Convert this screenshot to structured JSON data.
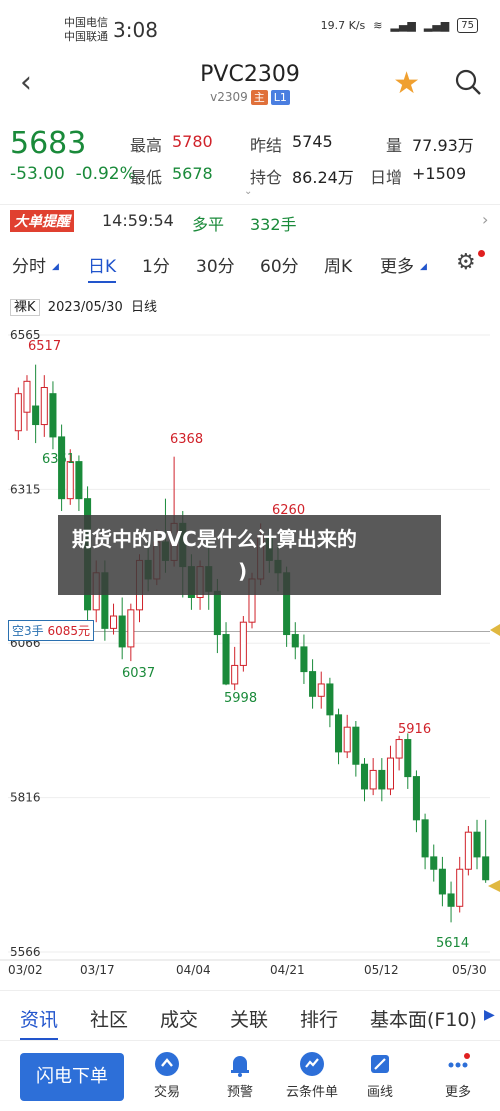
{
  "status": {
    "carrier1": "中国电信",
    "carrier2": "中国联通",
    "time": "3:08",
    "speed": "19.7 K/s",
    "battery": "75"
  },
  "nav": {
    "title": "PVC2309",
    "subtitle": "v2309",
    "tag_main": "主",
    "tag_l1": "L1"
  },
  "quote": {
    "price": "5683",
    "change": "-53.00",
    "pct": "-0.92%",
    "high_label": "最高",
    "high": "5780",
    "low_label": "最低",
    "low": "5678",
    "prev_label": "昨结",
    "prev": "5745",
    "oi_label": "持仓",
    "oi": "86.24万",
    "vol_label": "量",
    "vol": "77.93万",
    "day_label": "日增",
    "day": "+1509"
  },
  "alert": {
    "brand": "大单提醒",
    "time": "14:59:54",
    "type": "多平",
    "qty": "332手"
  },
  "tabs": [
    "分时",
    "日K",
    "1分",
    "30分",
    "60分",
    "周K",
    "更多"
  ],
  "chart": {
    "kind": "裸K",
    "date": "2023/05/30",
    "period": "日线",
    "position": "空3手",
    "position_price": "6085元"
  },
  "overlay": {
    "line1": "期货中的PVC是什么计算出来的",
    "line2": ")"
  },
  "bottom_tabs": [
    "资讯",
    "社区",
    "成交",
    "关联",
    "排行",
    "基本面(F10)"
  ],
  "bottom_bar": {
    "flash": "闪电下单",
    "items": [
      "交易",
      "预警",
      "云条件单",
      "画线",
      "更多"
    ]
  },
  "chart_data": {
    "type": "candlestick",
    "yticks": [
      6565,
      6315,
      6066,
      5816,
      5566
    ],
    "ylim": [
      5566,
      6565
    ],
    "xticks": [
      "03/02",
      "03/17",
      "04/04",
      "04/21",
      "05/12",
      "05/30"
    ],
    "annotations": [
      {
        "label": "6517"
      },
      {
        "label": "6368"
      },
      {
        "label": "6037"
      },
      {
        "label": "6260"
      },
      {
        "label": "5998"
      },
      {
        "label": "5916"
      },
      {
        "label": "5614"
      },
      {
        "label": "6361"
      }
    ],
    "candles": [
      [
        6410,
        6470,
        6395,
        6480
      ],
      [
        6440,
        6490,
        6410,
        6500
      ],
      [
        6450,
        6420,
        6390,
        6517
      ],
      [
        6420,
        6480,
        6400,
        6500
      ],
      [
        6470,
        6400,
        6380,
        6490
      ],
      [
        6400,
        6300,
        6280,
        6420
      ],
      [
        6300,
        6360,
        6290,
        6380
      ],
      [
        6360,
        6300,
        6280,
        6370
      ],
      [
        6300,
        6120,
        6100,
        6320
      ],
      [
        6120,
        6180,
        6100,
        6200
      ],
      [
        6180,
        6090,
        6070,
        6200
      ],
      [
        6090,
        6110,
        6080,
        6130
      ],
      [
        6110,
        6060,
        6040,
        6140
      ],
      [
        6060,
        6120,
        6037,
        6130
      ],
      [
        6120,
        6200,
        6100,
        6210
      ],
      [
        6200,
        6170,
        6150,
        6230
      ],
      [
        6170,
        6230,
        6160,
        6250
      ],
      [
        6230,
        6200,
        6180,
        6300
      ],
      [
        6200,
        6260,
        6190,
        6368
      ],
      [
        6260,
        6190,
        6140,
        6280
      ],
      [
        6190,
        6140,
        6120,
        6210
      ],
      [
        6140,
        6190,
        6120,
        6200
      ],
      [
        6190,
        6150,
        6120,
        6230
      ],
      [
        6150,
        6080,
        6050,
        6170
      ],
      [
        6080,
        6000,
        5998,
        6100
      ],
      [
        6000,
        6030,
        5990,
        6060
      ],
      [
        6030,
        6100,
        6020,
        6110
      ],
      [
        6100,
        6170,
        6090,
        6180
      ],
      [
        6170,
        6240,
        6160,
        6260
      ],
      [
        6240,
        6200,
        6180,
        6250
      ],
      [
        6200,
        6180,
        6150,
        6230
      ],
      [
        6180,
        6080,
        6060,
        6190
      ],
      [
        6080,
        6060,
        6040,
        6100
      ],
      [
        6060,
        6020,
        6000,
        6080
      ],
      [
        6020,
        5980,
        5960,
        6040
      ],
      [
        5980,
        6000,
        5960,
        6020
      ],
      [
        6000,
        5950,
        5930,
        6010
      ],
      [
        5950,
        5890,
        5870,
        5960
      ],
      [
        5890,
        5930,
        5880,
        5950
      ],
      [
        5930,
        5870,
        5850,
        5940
      ],
      [
        5870,
        5830,
        5810,
        5880
      ],
      [
        5830,
        5860,
        5820,
        5880
      ],
      [
        5860,
        5830,
        5810,
        5880
      ],
      [
        5830,
        5880,
        5820,
        5900
      ],
      [
        5880,
        5910,
        5860,
        5916
      ],
      [
        5910,
        5850,
        5830,
        5920
      ],
      [
        5850,
        5780,
        5760,
        5860
      ],
      [
        5780,
        5720,
        5700,
        5790
      ],
      [
        5720,
        5700,
        5680,
        5740
      ],
      [
        5700,
        5660,
        5640,
        5720
      ],
      [
        5660,
        5640,
        5614,
        5680
      ],
      [
        5640,
        5700,
        5630,
        5720
      ],
      [
        5700,
        5760,
        5690,
        5770
      ],
      [
        5760,
        5720,
        5700,
        5780
      ],
      [
        5720,
        5683,
        5678,
        5780
      ]
    ]
  }
}
